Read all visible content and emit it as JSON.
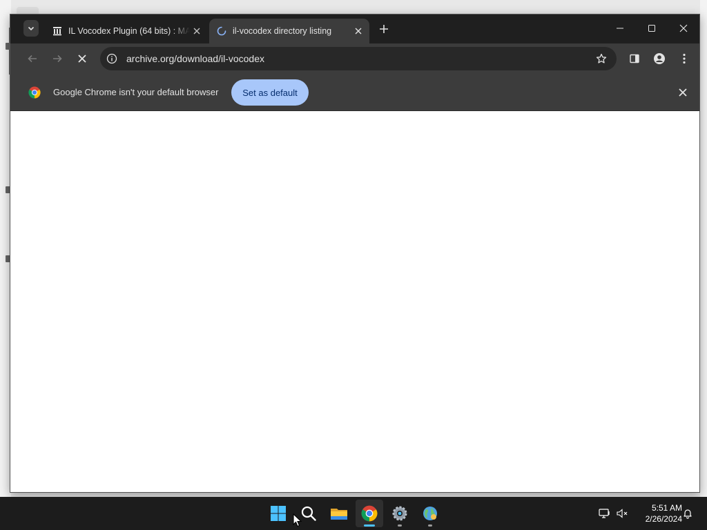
{
  "window": {
    "tabs": [
      {
        "title": "IL Vocodex Plugin (64 bits) : MA",
        "favicon": "archive-institution-icon",
        "active": false
      },
      {
        "title": "il-vocodex directory listing",
        "favicon": "loading-spinner-icon",
        "active": true
      }
    ]
  },
  "toolbar": {
    "url": "archive.org/download/il-vocodex",
    "loading": true
  },
  "infobar": {
    "message": "Google Chrome isn't your default browser",
    "button_label": "Set as default"
  },
  "taskbar": {
    "apps": [
      "start-icon",
      "search-icon",
      "file-explorer-icon",
      "chrome-icon",
      "settings-icon",
      "globe-app-icon"
    ],
    "time": "5:51 AM",
    "date": "2/26/2024"
  },
  "colors": {
    "tabstrip": "#1f1f1f",
    "toolbar": "#3c3c3c",
    "accent_button": "#a8c7fa",
    "taskbar": "#1c1c1c",
    "active_indicator": "#4cc2ff"
  }
}
